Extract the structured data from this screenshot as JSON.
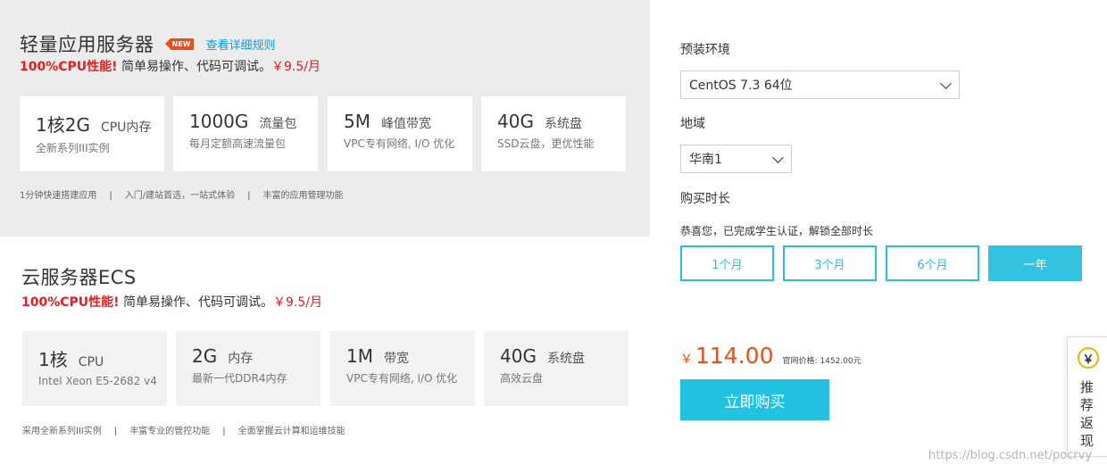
{
  "products": [
    {
      "title": "轻量应用服务器",
      "badge": "NEW",
      "rule_link": "查看详细规则",
      "slogan": {
        "hot": "100%CPU性能!",
        "text": " 简单易操作、代码可调试。",
        "price": "￥9.5/月"
      },
      "specs": [
        {
          "big": "1核2G",
          "mid": "CPU内存",
          "sub": "全新系列III实例"
        },
        {
          "big": "1000G",
          "mid": "流量包",
          "sub": "每月定额高速流量包"
        },
        {
          "big": "5M",
          "mid": "峰值带宽",
          "sub": "VPC专有网络, I/O 优化"
        },
        {
          "big": "40G",
          "mid": "系统盘",
          "sub": "SSD云盘，更优性能"
        }
      ],
      "features": [
        "1分钟快速搭建应用",
        "入门/建站首选，一站式体验",
        "丰富的应用管理功能"
      ]
    },
    {
      "title": "云服务器ECS",
      "slogan": {
        "hot": "100%CPU性能!",
        "text": " 简单易操作、代码可调试。",
        "price": "￥9.5/月"
      },
      "specs": [
        {
          "big": "1核",
          "mid": "CPU",
          "sub": "Intel Xeon E5-2682 v4"
        },
        {
          "big": "2G",
          "mid": "内存",
          "sub": "最新一代DDR4内存"
        },
        {
          "big": "1M",
          "mid": "带宽",
          "sub": "VPC专有网络, I/O 优化"
        },
        {
          "big": "40G",
          "mid": "系统盘",
          "sub": "高效云盘"
        }
      ],
      "features": [
        "采用全新系列III实例",
        "丰富专业的管控功能",
        "全面掌握云计算和运维技能"
      ]
    }
  ],
  "config": {
    "env_label": "预装环境",
    "env_value": "CentOS 7.3 64位",
    "region_label": "地域",
    "region_value": "华南1",
    "duration_label": "购买时长",
    "student_note": "恭喜您，已完成学生认证，解锁全部时长",
    "durations": [
      "1个月",
      "3个月",
      "6个月",
      "一年"
    ],
    "selected_duration": "一年"
  },
  "pricing": {
    "currency": "￥",
    "amount": "114.00",
    "original": "官网价格: 1452.00元",
    "buy_label": "立即购买"
  },
  "float_tab": {
    "coin": "￥",
    "text": "推荐返现"
  },
  "watermark": "https://blog.csdn.net/pocrvy"
}
